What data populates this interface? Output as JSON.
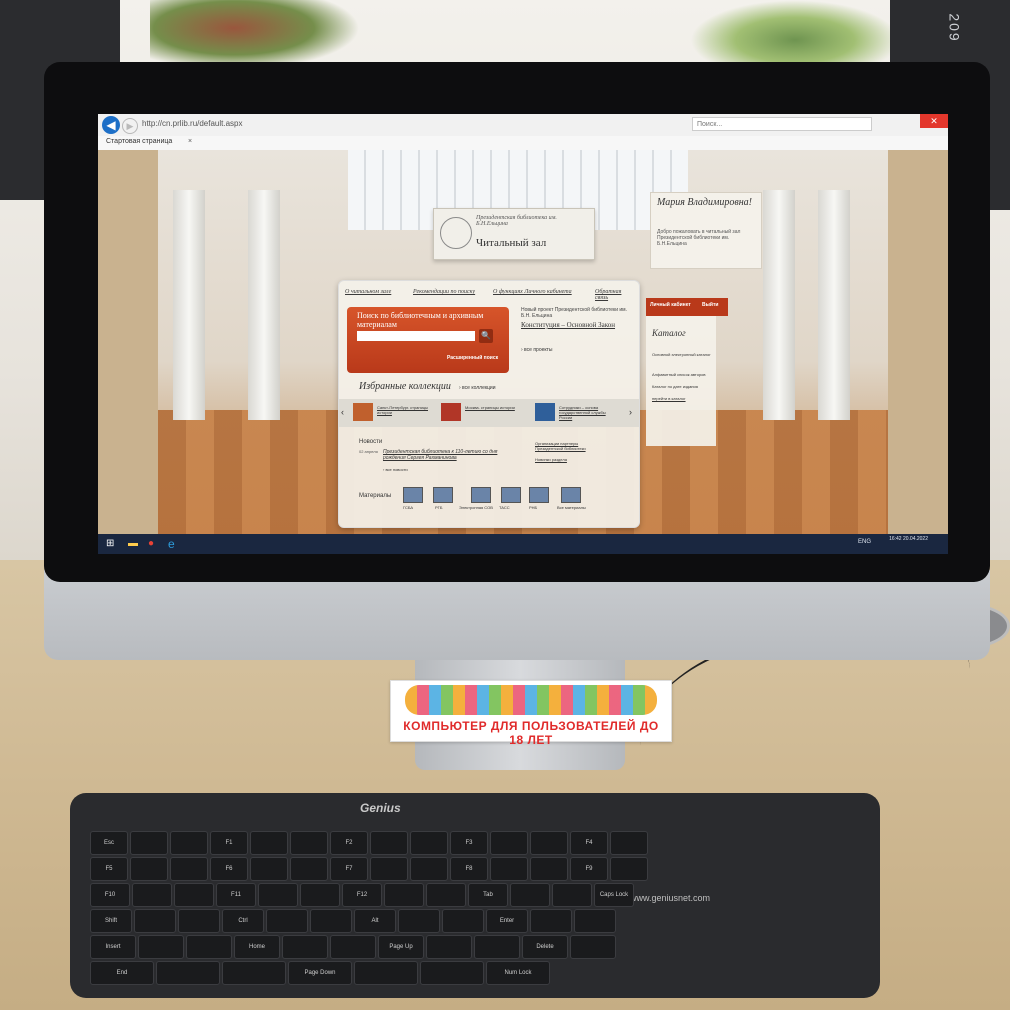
{
  "browser": {
    "url": "http://cn.prlib.ru/default.aspx",
    "search_placeholder": "Поиск...",
    "tab_title": "Стартовая страница",
    "close": "✕"
  },
  "site": {
    "sign_subtitle": "Президентская библиотека им. Б.Н.Ельцина",
    "sign_title": "Читальный зал",
    "greeting_name": "Мария Владимировна!",
    "greeting_text": "Добро пожаловать в читальный зал Президентской библиотеки им. Б.Н.Ельцина",
    "nav": [
      "О читальном зале",
      "Рекомендации по поиску",
      "О функциях Личного кабинета",
      "Обратная связь"
    ],
    "search_title": "Поиск по библиотечным и архивным материалам",
    "search_go": "🔍",
    "advanced_search": "Расширенный поиск",
    "project_text": "Новый проект Президентской библиотеки им. Б.Н. Ельцина",
    "project_link": "Конституция – Основной Закон",
    "all_projects": "› все проекты",
    "collections_title": "Избранные коллекции",
    "all_collections": "› все коллекции",
    "collections": [
      "Санкт-Петербург. страницы истории",
      "Москва. страницы истории",
      "Сотрудники – основа государственной службы России"
    ],
    "news_title": "Новости",
    "news_date": "02 апреля",
    "news_text": "Президентская библиотека к 110-летию со дня рождения Сергея Рахманинова",
    "all_news": "› все новости",
    "side_link_1": "Организации партнеры Президентской библиотеки",
    "side_link_2": "Новинки раздела",
    "materials_label": "Материалы",
    "materials": [
      "ГСБА",
      "РГБ",
      "Электронная СОВ",
      "ТАСС",
      "РНБ",
      "Все материалы"
    ],
    "cabinet": "Личный кабинет",
    "login": "Выйти",
    "catalog_title": "Каталог",
    "catalog_items": [
      "Основной электронный каталог",
      "Алфавитный список авторов",
      "Каталог по дате издания",
      "перейти в каталог"
    ]
  },
  "taskbar": {
    "lang": "ENG",
    "time": "16:42\n20.04.2022"
  },
  "sticker": {
    "text": "КОМПЬЮТЕР ДЛЯ ПОЛЬЗОВАТЕЛЕЙ ДО 18 ЛЕТ"
  },
  "keyboard": {
    "brand": "Genius",
    "site": "www.geniusnet.com",
    "keys": [
      "Esc",
      "F1",
      "F2",
      "F3",
      "F4",
      "F5",
      "F6",
      "F7",
      "F8",
      "F9",
      "F10",
      "F11",
      "F12",
      "Tab",
      "Caps Lock",
      "Shift",
      "Ctrl",
      "Alt",
      "Enter",
      "Insert",
      "Home",
      "Page Up",
      "Delete",
      "End",
      "Page Down",
      "Num Lock",
      "Del"
    ]
  },
  "room": {
    "monitor_label": "209"
  },
  "colors": {
    "accent": "#b9391a",
    "taskbar": "#1a2740",
    "sticker_text": "#e02b2b"
  }
}
